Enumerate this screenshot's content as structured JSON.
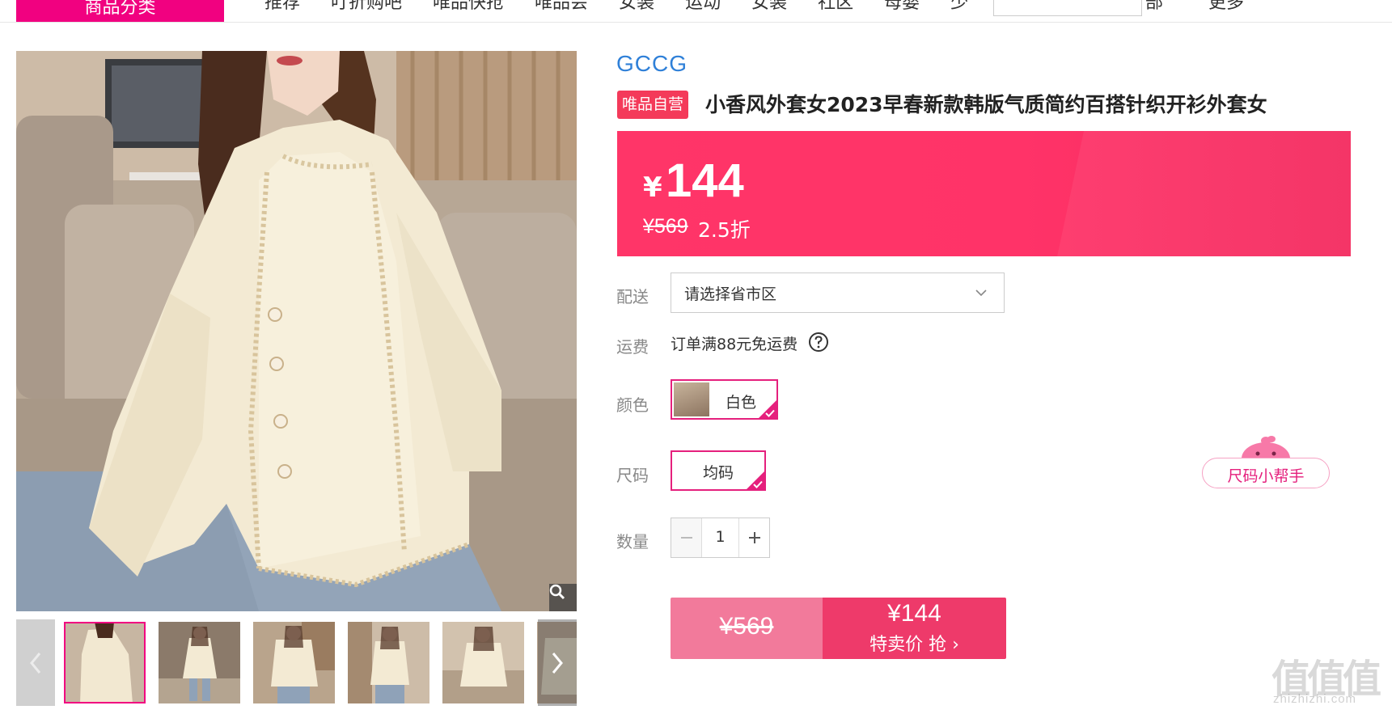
{
  "nav": {
    "category_button": "商品分类",
    "items": [
      "推荐",
      "叮折购吧",
      "唯品快抢",
      "唯品会",
      "女装",
      "运动",
      "女装",
      "社区",
      "母婴",
      "少",
      "部",
      "更多"
    ]
  },
  "gallery": {
    "zoom_icon": "magnifier-icon",
    "prev_icon": "chevron-left-icon",
    "next_icon": "chevron-right-icon",
    "thumb_count": 6
  },
  "product": {
    "brand": "GCCG",
    "self_tag": "唯品自营",
    "title": "小香风外套女2023早春新款韩版气质简约百搭针织开衫外套女"
  },
  "price": {
    "currency": "¥",
    "value": "144",
    "original": "¥569",
    "discount": "2.5折"
  },
  "delivery": {
    "label": "配送",
    "placeholder": "请选择省市区"
  },
  "shipping": {
    "label": "运费",
    "text": "订单满88元免运费"
  },
  "color": {
    "label": "颜色",
    "selected": "白色"
  },
  "size": {
    "label": "尺码",
    "selected": "均码",
    "helper": "尺码小帮手"
  },
  "quantity": {
    "label": "数量",
    "value": "1"
  },
  "buy": {
    "original": "¥569",
    "price": "¥144",
    "action": "特卖价 抢 ›"
  },
  "watermark": {
    "big": "值值值",
    "small": "zhizhizhi.com"
  },
  "colors": {
    "accent": "#f10180",
    "price_bg": "#ff3568",
    "brand": "#2f80d8"
  }
}
